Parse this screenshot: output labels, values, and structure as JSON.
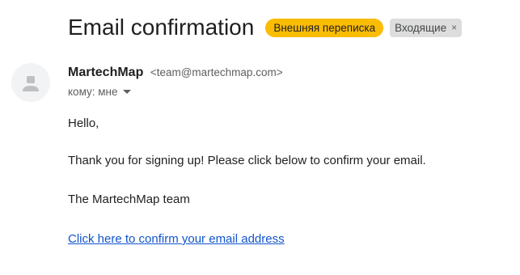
{
  "email": {
    "subject": "Email confirmation",
    "labels": {
      "external": "Внешняя переписка",
      "inbox": "Входящие",
      "inbox_remove": "×"
    },
    "sender": {
      "name": "MartechMap",
      "email": "<team@martechmap.com>"
    },
    "recipient": "кому: мне",
    "body": {
      "greeting": "Hello,",
      "message": "Thank you for signing up! Please click below to confirm your email.",
      "signature": "The MartechMap team",
      "confirm_link": "Click here to confirm your email address"
    }
  },
  "colors": {
    "external_label_bg": "#fbbc04",
    "inbox_label_bg": "#dddddd",
    "link": "#1155cc",
    "avatar_bg": "#f1f3f4",
    "avatar_icon": "#bdc1c6"
  },
  "icons": {
    "avatar": "default-person-icon",
    "recipient_details": "caret-down-icon",
    "remove_label": "close-icon"
  }
}
